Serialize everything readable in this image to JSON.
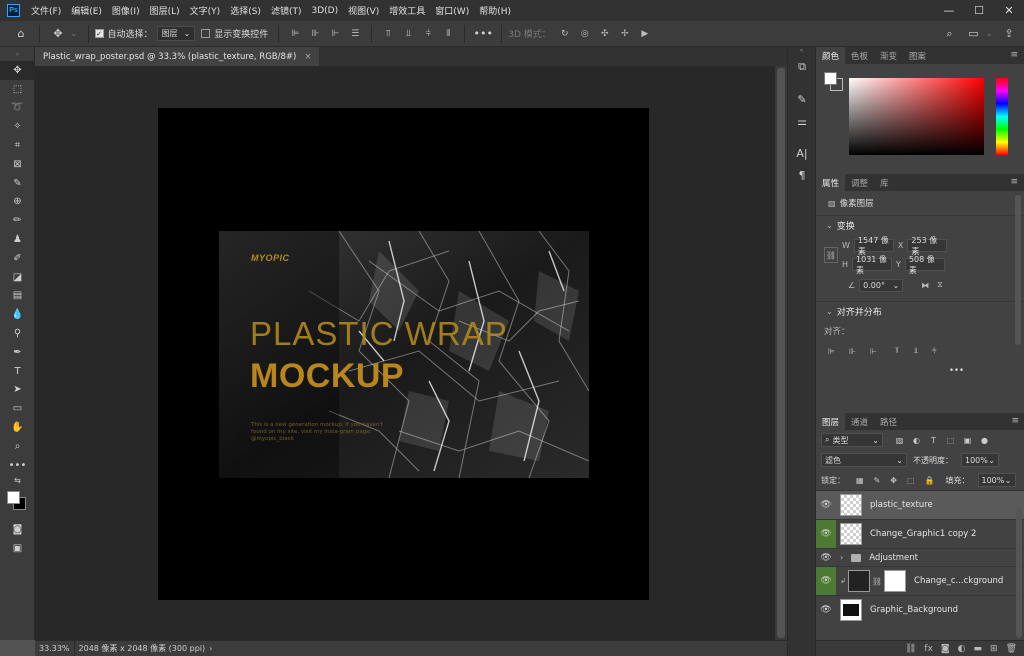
{
  "menubar": {
    "logo": "Ps",
    "items": [
      "文件(F)",
      "编辑(E)",
      "图像(I)",
      "图层(L)",
      "文字(Y)",
      "选择(S)",
      "滤镜(T)",
      "3D(D)",
      "视图(V)",
      "增效工具",
      "窗口(W)",
      "帮助(H)"
    ],
    "minimize": "—",
    "maximize": "☐",
    "close": "✕"
  },
  "options": {
    "auto_select_label": "自动选择：",
    "auto_select_value": "图层",
    "show_transform_label": "显示变换控件",
    "mode_3d_label": "3D 模式：",
    "more": "•••"
  },
  "document": {
    "tab_title": "Plastic_wrap_poster.psd @ 33.3% (plastic_texture, RGB/8#)",
    "tab_close": "×",
    "zoom": "33.33%",
    "doc_info": "2048 像素 x 2048 像素 (300 ppi)",
    "status_arrow": "›"
  },
  "poster": {
    "brand": "MYOPIC",
    "title_line1": "PLASTIC WRAP",
    "title_line2": "MOCKUP",
    "body_text": "This is a new generation mockup. If you haven't found on my site, visit my insta-gram page: @myopic_black",
    "colors": {
      "gold": "#b58a1c",
      "canvas": "#000000"
    }
  },
  "panels": {
    "color_tabs": [
      "颜色",
      "色板",
      "渐变",
      "图案"
    ],
    "properties_tabs": [
      "属性",
      "调整",
      "库"
    ],
    "pixel_layer_label": "像素图层",
    "transform_label": "变换",
    "w_label": "W",
    "w_value": "1547 像素",
    "h_label": "H",
    "h_value": "1031 像素",
    "x_label": "X",
    "x_value": "253 像素",
    "y_label": "Y",
    "y_value": "508 像素",
    "angle_value": "0.00°",
    "align_section_label": "对齐并分布",
    "align_label": "对齐：",
    "more": "•••"
  },
  "layers": {
    "tabs": [
      "图层",
      "通道",
      "路径"
    ],
    "filter_label": "类型",
    "blend_mode": "滤色",
    "opacity_label": "不透明度：",
    "opacity_value": "100%",
    "lock_label": "锁定：",
    "fill_label": "填充：",
    "fill_value": "100%",
    "items": [
      {
        "name": "plastic_texture"
      },
      {
        "name": "Change_Graphic1 copy 2"
      },
      {
        "name": "Adjustment"
      },
      {
        "name": "Change_c...ckground"
      },
      {
        "name": "Graphic_Background"
      }
    ],
    "bottom_icons": [
      "link-icon",
      "fx-icon",
      "mask-icon",
      "adjustment-icon",
      "group-icon",
      "new-layer-icon",
      "trash-icon"
    ]
  }
}
